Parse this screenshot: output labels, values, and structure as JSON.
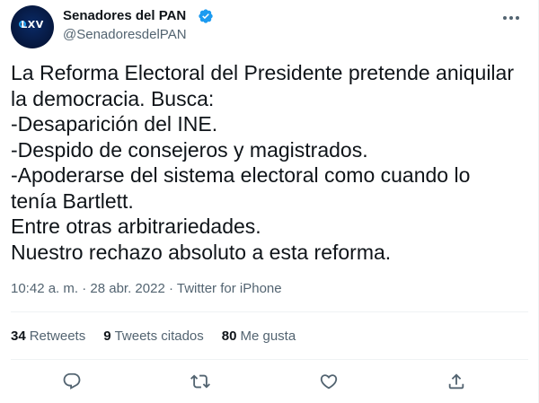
{
  "account": {
    "display_name": "Senadores del PAN",
    "handle": "@SenadoresdelPAN",
    "avatar_text": "LXV",
    "verified": true
  },
  "tweet": {
    "lines": [
      "La Reforma Electoral del Presidente pretende aniquilar",
      "la democracia. Busca:",
      "-Desaparición del INE.",
      "-Despido de consejeros y magistrados.",
      "-Apoderarse del sistema electoral como cuando lo",
      "tenía Bartlett.",
      "Entre otras arbitrariedades.",
      "Nuestro rechazo absoluto a esta reforma."
    ]
  },
  "meta": {
    "time": "10:42 a. m.",
    "separator1": " · ",
    "date": "28 abr. 2022",
    "separator2": " · ",
    "source": "Twitter for iPhone"
  },
  "stats": {
    "retweets_count": "34",
    "retweets_label": "Retweets",
    "quotes_count": "9",
    "quotes_label": "Tweets citados",
    "likes_count": "80",
    "likes_label": "Me gusta"
  },
  "icons": {
    "verified": "verified-badge-icon",
    "more": "more-icon",
    "reply": "reply-icon",
    "retweet": "retweet-icon",
    "like": "like-icon",
    "share": "share-icon"
  },
  "colors": {
    "text": "#0f1419",
    "secondary": "#536471",
    "verified": "#1d9bf0",
    "divider": "#eff3f4"
  }
}
